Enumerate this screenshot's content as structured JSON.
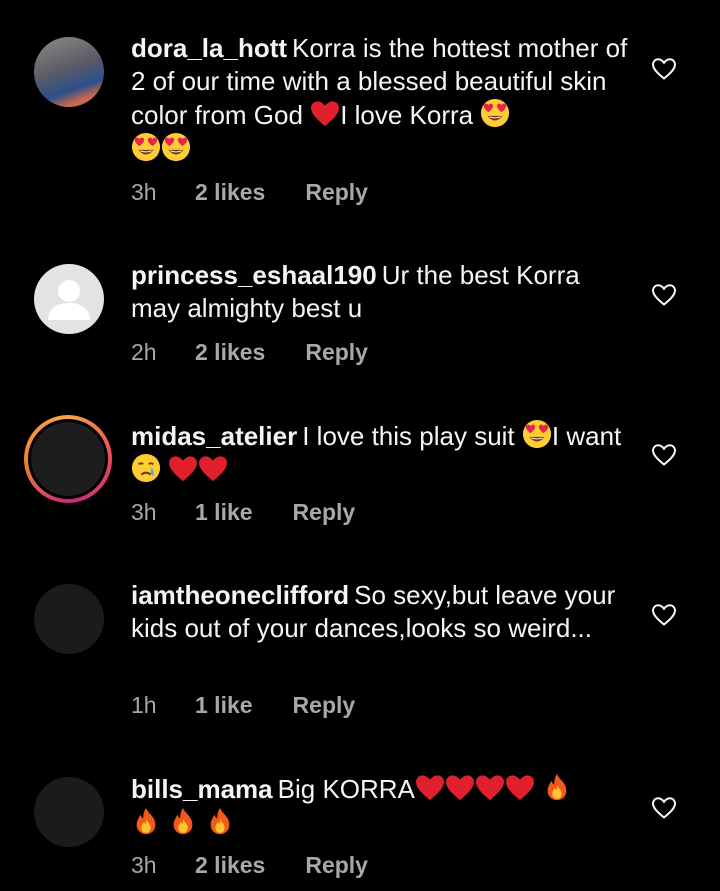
{
  "comments": [
    {
      "username": "dora_la_hott",
      "text": "Korra is the hottest mother of 2 of our time with a blessed beautiful skin color from God",
      "text2": "I love Korra",
      "time": "3h",
      "likes": "2 likes",
      "reply": "Reply"
    },
    {
      "username": "princess_eshaal190",
      "text": "Ur the best Korra may almighty best u",
      "time": "2h",
      "likes": "2 likes",
      "reply": "Reply"
    },
    {
      "username": "midas_atelier",
      "text": "I love this play suit",
      "text2": "I want",
      "time": "3h",
      "likes": "1 like",
      "reply": "Reply"
    },
    {
      "username": "iamtheoneclifford",
      "text": "So sexy,but leave your kids out of your dances,looks so weird...",
      "time": "1h",
      "likes": "1 like",
      "reply": "Reply"
    },
    {
      "username": "bills_mama",
      "text": "Big KORRA",
      "time": "3h",
      "likes": "2 likes",
      "reply": "Reply"
    }
  ],
  "icons": {
    "like": "heart-outline-icon",
    "emojis": [
      "red-heart-emoji",
      "heart-eyes-emoji",
      "crying-emoji",
      "fire-emoji"
    ]
  },
  "colors": {
    "background": "#000000",
    "text": "#f5f5f5",
    "meta": "#a8a8a8",
    "story_ring": "#e9485e"
  }
}
